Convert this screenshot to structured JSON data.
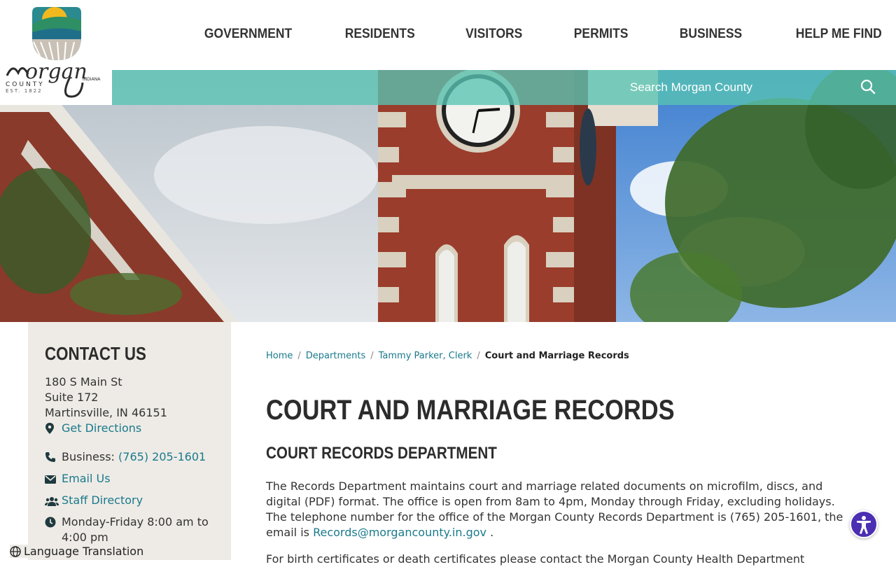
{
  "brand": {
    "logo_name": "Morgan",
    "logo_county": "COUNTY",
    "logo_state": "INDIANA",
    "logo_est": "EST. 1822"
  },
  "nav": {
    "items": [
      "GOVERNMENT",
      "RESIDENTS",
      "VISITORS",
      "PERMITS",
      "BUSINESS",
      "HELP ME FIND"
    ]
  },
  "search": {
    "placeholder": "Search Morgan County"
  },
  "contact": {
    "heading": "CONTACT US",
    "address_line1": "180 S Main St",
    "address_line2": "Suite 172",
    "address_line3": "Martinsville, IN 46151",
    "directions_label": "Get Directions",
    "business_label": "Business:",
    "business_phone": "(765) 205-1601",
    "email_label": "Email Us",
    "staff_label": "Staff Directory",
    "hours": "Monday-Friday 8:00 am to 4:00 pm"
  },
  "breadcrumb": {
    "home": "Home",
    "departments": "Departments",
    "clerk": "Tammy Parker, Clerk",
    "current": "Court and Marriage Records"
  },
  "content": {
    "title": "COURT AND MARRIAGE RECORDS",
    "section_title": "COURT RECORDS DEPARTMENT",
    "paragraph": "The Records Department maintains court and marriage related documents on microfilm, discs, and digital (PDF) format.  The office is open from 8am to 4pm, Monday through Friday, excluding holidays.  The telephone number for the office of the Morgan County Records Department is (765) 205-1601, the email is",
    "email_link": "Records@morgancounty.in.gov",
    "paragraph_end": " .",
    "paragraph2": "For birth certificates or death certificates please contact the Morgan County Health Department"
  },
  "footer": {
    "language_label": "Language Translation"
  },
  "colors": {
    "teal_link": "#1a7a8c",
    "search_band": "#58c4b4",
    "sidebar_bg": "#eeebe6",
    "accessibility": "#4b2fb3"
  }
}
